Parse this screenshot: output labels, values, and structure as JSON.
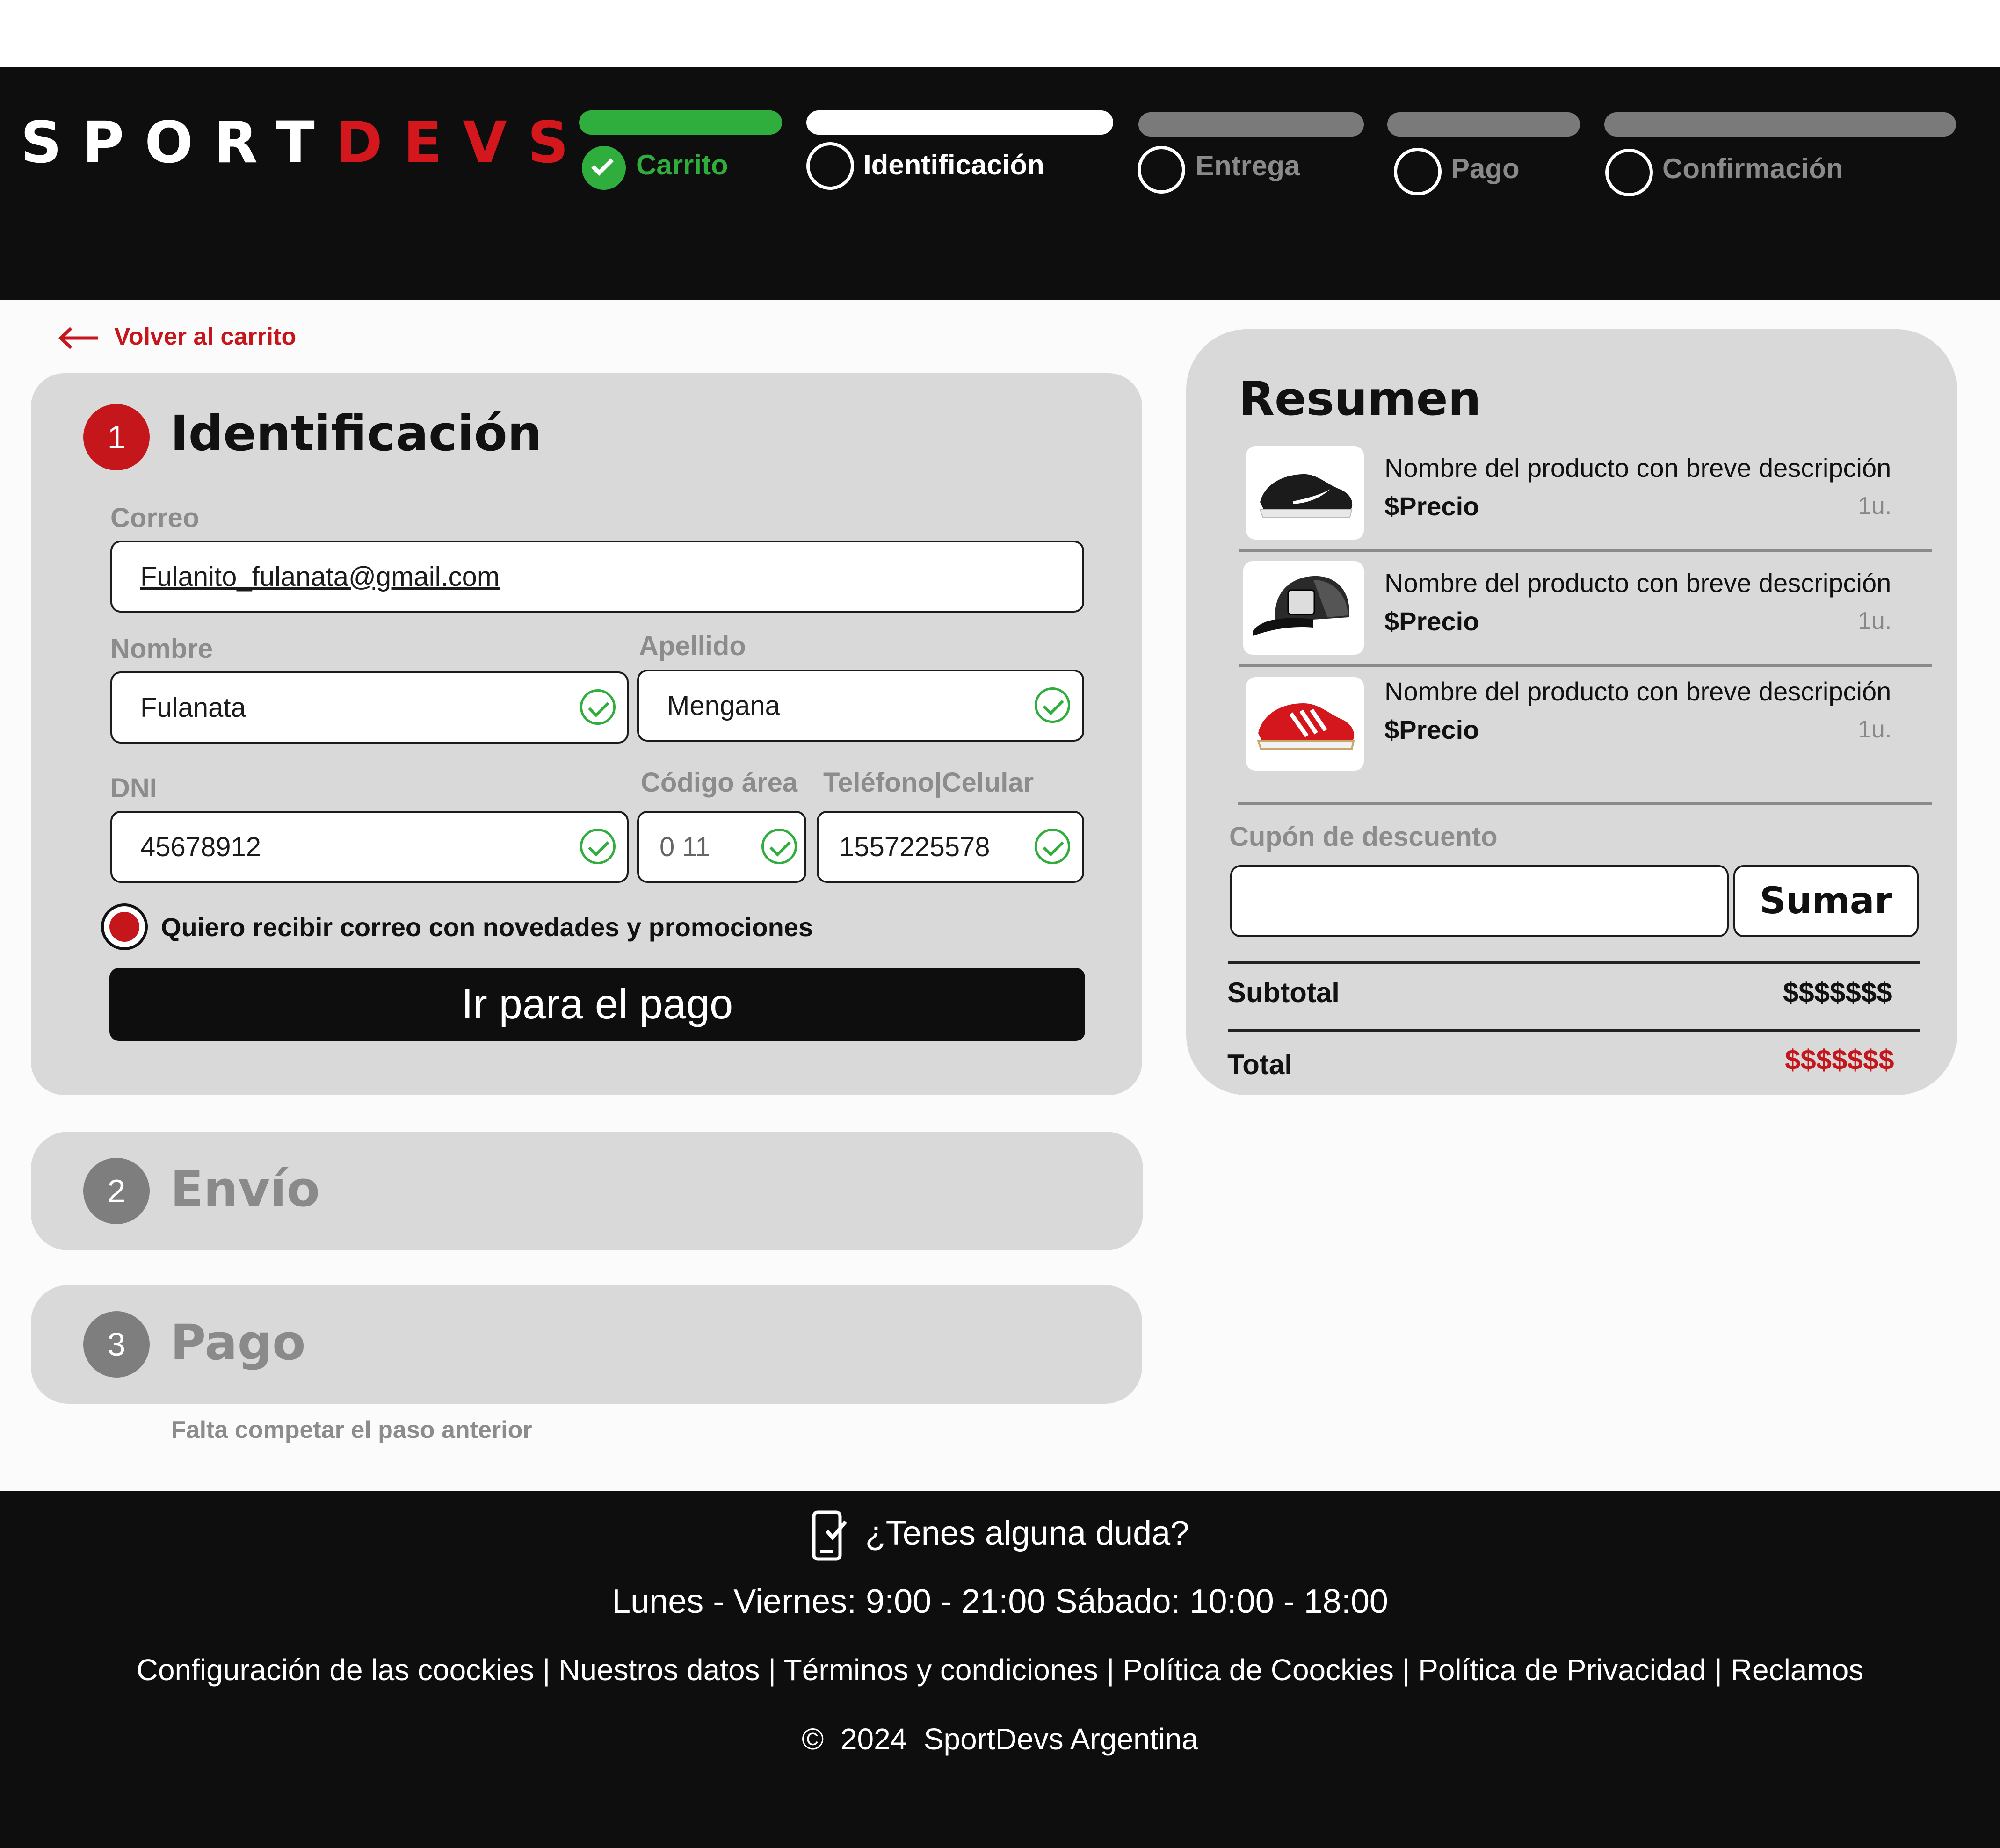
{
  "brand": {
    "part1": "SPORT",
    "part2": "DEVS"
  },
  "steps": [
    {
      "label": "Carrito",
      "state": "done"
    },
    {
      "label": "Identificación",
      "state": "current"
    },
    {
      "label": "Entrega",
      "state": "pending"
    },
    {
      "label": "Pago",
      "state": "pending"
    },
    {
      "label": "Confirmación",
      "state": "pending"
    }
  ],
  "back_link": "Volver al carrito",
  "identificacion": {
    "number": "1",
    "title": "Identificación",
    "email_label": "Correo",
    "email_value": "Fulanito_fulanata@gmail.com",
    "nombre_label": "Nombre",
    "nombre_value": "Fulanata",
    "apellido_label": "Apellido",
    "apellido_value": "Mengana",
    "dni_label": "DNI",
    "dni_value": "45678912",
    "area_label": "Código área",
    "area_value": "0 11",
    "telefono_label": "Teléfono|Celular",
    "telefono_value": "1557225578",
    "newsletter_label": "Quiero recibir correo con novedades y promociones",
    "newsletter_checked": true,
    "submit_label": "Ir para el pago"
  },
  "envio": {
    "number": "2",
    "title": "Envío"
  },
  "pago": {
    "number": "3",
    "title": "Pago",
    "note": "Falta competar el paso anterior"
  },
  "summary": {
    "title": "Resumen",
    "items": [
      {
        "name": "Nombre del producto con breve descripción",
        "price": "$Precio",
        "qty": "1u.",
        "image": "black-sneaker"
      },
      {
        "name": "Nombre del producto con breve descripción",
        "price": "$Precio",
        "qty": "1u.",
        "image": "black-cap"
      },
      {
        "name": "Nombre del producto con breve descripción",
        "price": "$Precio",
        "qty": "1u.",
        "image": "red-sneaker"
      }
    ],
    "coupon_label": "Cupón de descuento",
    "coupon_value": "",
    "coupon_button": "Sumar",
    "subtotal_label": "Subtotal",
    "subtotal_value": "$$$$$$$",
    "total_label": "Total",
    "total_value": "$$$$$$$"
  },
  "footer": {
    "help_icon": "phone-check-icon",
    "help_text": "¿Tenes alguna duda?",
    "hours": "Lunes - Viernes: 9:00 - 21:00 Sábado: 10:00 - 18:00",
    "links": [
      "Configuración de las coockies",
      "Nuestros datos",
      "Términos y condiciones",
      "Política de Coockies",
      "Política de Privacidad",
      "Reclamos"
    ],
    "copyright_symbol": "©",
    "year": "2024",
    "company": "SportDevs Argentina"
  },
  "colors": {
    "brand_red": "#d3171d",
    "success_green": "#2fae3e",
    "dark": "#0e0e0e",
    "panel": "#d9d9d9"
  }
}
